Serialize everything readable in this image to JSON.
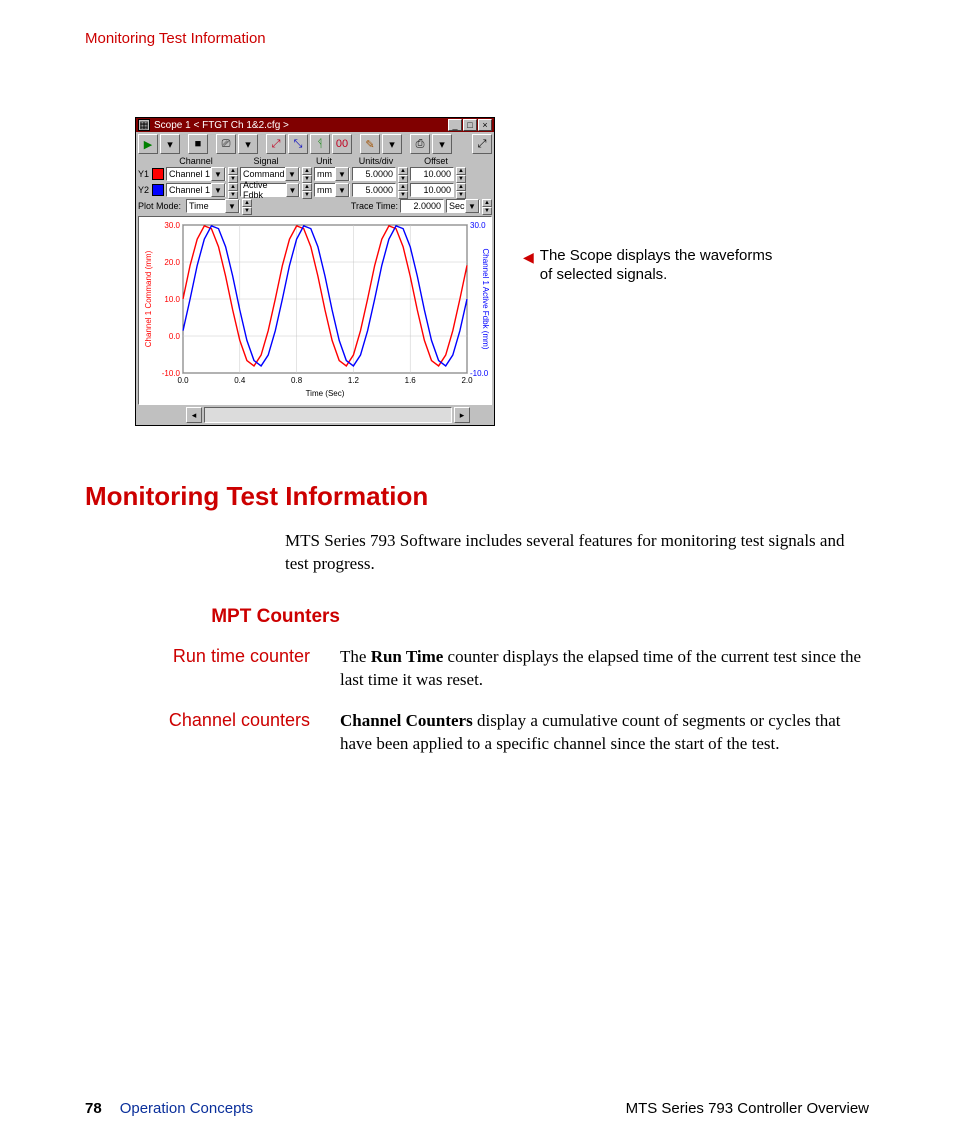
{
  "running_header": "Monitoring Test Information",
  "scope": {
    "window_title": "Scope  1 < FTGT Ch 1&2.cfg >",
    "columns": {
      "channel": "Channel",
      "signal": "Signal",
      "unit": "Unit",
      "units_div": "Units/div",
      "offset": "Offset"
    },
    "rows": [
      {
        "label": "Y1",
        "color": "#ff0000",
        "channel": "Channel 1",
        "signal": "Command",
        "unit": "mm",
        "units_div": "5.0000",
        "offset": "10.000"
      },
      {
        "label": "Y2",
        "color": "#0000ff",
        "channel": "Channel 1",
        "signal": "Active Fdbk",
        "unit": "mm",
        "units_div": "5.0000",
        "offset": "10.000"
      }
    ],
    "plot_mode_label": "Plot Mode:",
    "plot_mode_value": "Time",
    "trace_time_label": "Trace Time:",
    "trace_time_value": "2.0000",
    "trace_time_unit": "Sec",
    "xlabel": "Time (Sec)",
    "y1_axis_label": "Channel 1 Command (mm)",
    "y2_axis_label": "Channel 1 Active Fdbk (mm)",
    "y_ticks_left": [
      "30.0",
      "20.0",
      "10.0",
      "0.0",
      "-10.0"
    ],
    "y_ticks_right": [
      "30.0",
      "-10.0"
    ],
    "x_ticks": [
      "0.0",
      "0.4",
      "0.8",
      "1.2",
      "1.6",
      "2.0"
    ]
  },
  "callout": {
    "line1": "The Scope displays the waveforms",
    "line2": "of selected signals."
  },
  "heading": "Monitoring Test Information",
  "intro": "MTS Series 793 Software includes several features for monitoring test signals and test progress.",
  "subheading": "MPT Counters",
  "defs": {
    "runtime_term": "Run time counter",
    "runtime_bold": "Run Time",
    "runtime_rest": " counter displays the elapsed time of the current test since the last time it was reset.",
    "chcnt_term": "Channel counters",
    "chcnt_bold": "Channel Counters",
    "chcnt_rest": " display a cumulative count of segments or cycles that have been applied to a specific channel since the start of the test."
  },
  "footer": {
    "page": "78",
    "section": "Operation Concepts",
    "doc": "MTS Series 793 Controller Overview"
  },
  "chart_data": {
    "type": "line",
    "title": "Scope 1",
    "xlabel": "Time (Sec)",
    "xlim": [
      0.0,
      2.0
    ],
    "ylim": [
      -10.0,
      30.0
    ],
    "x": [
      0.0,
      0.05,
      0.1,
      0.15,
      0.2,
      0.25,
      0.3,
      0.35,
      0.4,
      0.45,
      0.5,
      0.55,
      0.6,
      0.65,
      0.7,
      0.75,
      0.8,
      0.85,
      0.9,
      0.95,
      1.0,
      1.05,
      1.1,
      1.15,
      1.2,
      1.25,
      1.3,
      1.35,
      1.4,
      1.45,
      1.5,
      1.55,
      1.6,
      1.65,
      1.7,
      1.75,
      1.8,
      1.85,
      1.9,
      1.95,
      2.0
    ],
    "series": [
      {
        "name": "Channel 1 Command (mm)",
        "color": "#ff0000",
        "values": [
          10.0,
          19.08,
          26.18,
          29.76,
          29.02,
          24.14,
          16.18,
          7.02,
          -1.18,
          -6.63,
          -8.09,
          -5.14,
          1.44,
          10.0,
          19.08,
          26.18,
          29.76,
          29.02,
          24.14,
          16.18,
          7.02,
          -1.18,
          -6.63,
          -8.09,
          -5.14,
          1.44,
          10.0,
          19.08,
          26.18,
          29.76,
          29.02,
          24.14,
          16.18,
          7.02,
          -1.18,
          -6.63,
          -8.09,
          -5.14,
          1.44,
          10.0,
          19.08
        ]
      },
      {
        "name": "Channel 1 Active Fdbk (mm)",
        "color": "#0000ff",
        "values": [
          1.44,
          10.0,
          19.08,
          26.18,
          29.76,
          29.02,
          24.14,
          16.18,
          7.02,
          -1.18,
          -6.63,
          -8.09,
          -5.14,
          1.44,
          10.0,
          19.08,
          26.18,
          29.76,
          29.02,
          24.14,
          16.18,
          7.02,
          -1.18,
          -6.63,
          -8.09,
          -5.14,
          1.44,
          10.0,
          19.08,
          26.18,
          29.76,
          29.02,
          24.14,
          16.18,
          7.02,
          -1.18,
          -6.63,
          -8.09,
          -5.14,
          1.44,
          10.0
        ]
      }
    ]
  }
}
